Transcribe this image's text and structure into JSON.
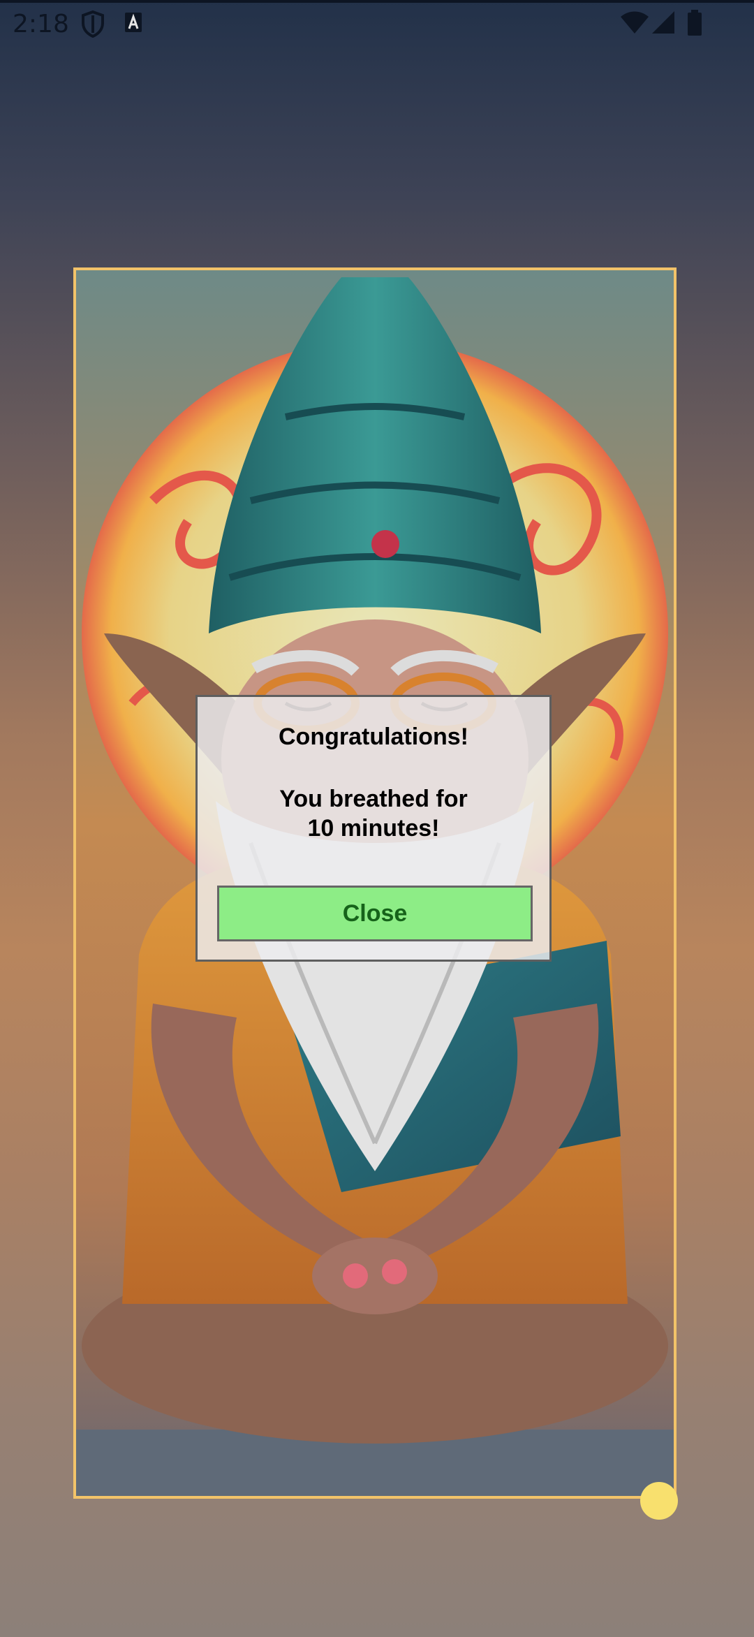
{
  "status_bar": {
    "time": "2:18",
    "icons": [
      "shield-icon",
      "a-box-icon",
      "wifi-icon",
      "signal-icon",
      "battery-icon"
    ]
  },
  "image": {
    "description_icon": "meditating-gnome-illustration",
    "frame_color": "#f2c369"
  },
  "dialog": {
    "title": "Congratulations!",
    "message": "You breathed for\n10 minutes!",
    "close_label": "Close",
    "button_color": "#8ded86"
  },
  "handle_color": "#f8e06e"
}
